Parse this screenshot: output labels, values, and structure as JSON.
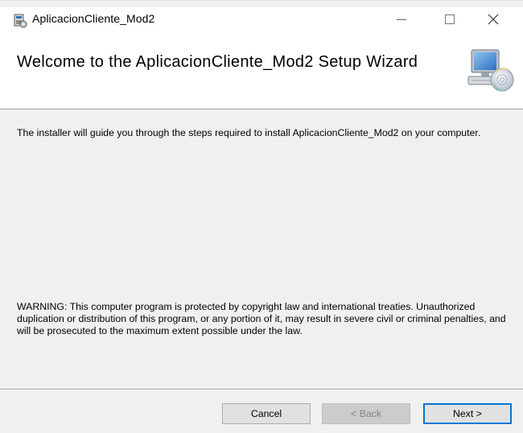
{
  "window": {
    "title": "AplicacionCliente_Mod2",
    "controls": {
      "minimize": "minimize",
      "maximize": "maximize",
      "close": "close"
    }
  },
  "banner": {
    "title": "Welcome to the AplicacionCliente_Mod2 Setup Wizard",
    "icon": "computer-cd-icon"
  },
  "body": {
    "intro": "The installer will guide you through the steps required to install AplicacionCliente_Mod2 on your computer.",
    "warning": "WARNING: This computer program is protected by copyright law and international treaties. Unauthorized duplication or distribution of this program, or any portion of it, may result in severe civil or criminal penalties, and will be prosecuted to the maximum extent possible under the law."
  },
  "buttons": {
    "cancel": "Cancel",
    "back": "< Back",
    "next": "Next >"
  },
  "colors": {
    "accent": "#0078d7",
    "window_bg": "#f0f0f0",
    "banner_bg": "#ffffff"
  }
}
